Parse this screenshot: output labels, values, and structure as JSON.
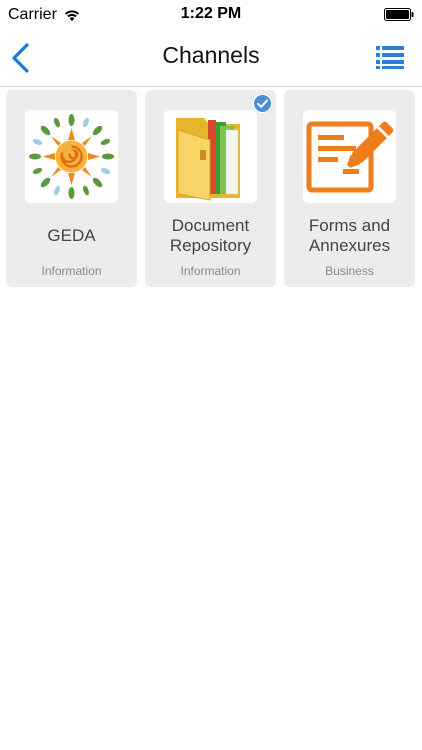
{
  "status_bar": {
    "carrier": "Carrier",
    "time": "1:22 PM"
  },
  "nav": {
    "title": "Channels"
  },
  "colors": {
    "accent": "#1a7ad9",
    "card_bg": "#ececec",
    "badge": "#4a90d9"
  },
  "channels": [
    {
      "title": "GEDA",
      "category": "Information",
      "icon": "geda-logo-icon",
      "selected": false
    },
    {
      "title": "Document Repository",
      "category": "Information",
      "icon": "folder-icon",
      "selected": true
    },
    {
      "title": "Forms and Annexures",
      "category": "Business",
      "icon": "form-pen-icon",
      "selected": false
    }
  ]
}
